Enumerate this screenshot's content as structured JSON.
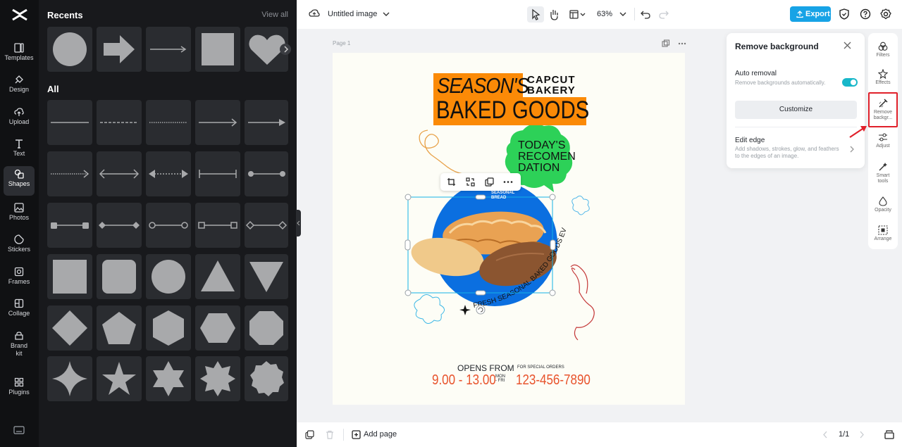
{
  "colors": {
    "accent": "#17a3e6",
    "highlight": "#e0202a",
    "toggle": "#18b7c9",
    "poster_orange": "#fb8a07",
    "poster_blue": "#0b6fe0",
    "poster_green": "#2dd158",
    "poster_red": "#e8532c"
  },
  "rail": {
    "items": [
      {
        "label": "Templates",
        "icon": "templates-icon"
      },
      {
        "label": "Design",
        "icon": "design-icon"
      },
      {
        "label": "Upload",
        "icon": "upload-icon"
      },
      {
        "label": "Text",
        "icon": "text-icon"
      },
      {
        "label": "Shapes",
        "icon": "shapes-icon"
      },
      {
        "label": "Photos",
        "icon": "photos-icon"
      },
      {
        "label": "Stickers",
        "icon": "stickers-icon"
      },
      {
        "label": "Frames",
        "icon": "frames-icon"
      },
      {
        "label": "Collage",
        "icon": "collage-icon"
      },
      {
        "label": "Brand kit",
        "icon": "brand-kit-icon"
      },
      {
        "label": "Plugins",
        "icon": "plugins-icon"
      }
    ]
  },
  "panel": {
    "recents_title": "Recents",
    "view_all": "View all",
    "all_title": "All"
  },
  "topbar": {
    "doc_title": "Untitled image",
    "zoom": "63%",
    "export_label": "Export"
  },
  "canvas": {
    "page_label": "Page 1",
    "poster": {
      "season": "SEASON'S",
      "capcut": "CAPCUT",
      "bakery": "BAKERY",
      "baked_goods": "BAKED GOODS",
      "today_1": "TODAY'S",
      "today_2": "RECOMEN",
      "today_3": "DATION",
      "seasonal": "SEASONAL",
      "bread": "BREAD",
      "curved_text": "FRESH SEASONAL BAKED GOODS EVERYDAY",
      "opens_from": "OPENS FROM",
      "hours": "9.00 - 13.00",
      "mon": "MON",
      "fri": "- FRI",
      "special_orders": "FOR SPECIAL ORDERS",
      "phone": "123-456-7890"
    }
  },
  "remove_bg": {
    "title": "Remove background",
    "auto_label": "Auto removal",
    "auto_desc": "Remove backgrounds automatically.",
    "auto_enabled": true,
    "customize": "Customize",
    "edge_label": "Edit edge",
    "edge_desc": "Add shadows, strokes, glow, and feathers to the edges of an image."
  },
  "right_tools": [
    {
      "label": "Filters",
      "icon": "filters-icon"
    },
    {
      "label": "Effects",
      "icon": "effects-icon"
    },
    {
      "label": "Remove backgr...",
      "icon": "remove-background-icon"
    },
    {
      "label": "Adjust",
      "icon": "adjust-icon"
    },
    {
      "label": "Smart tools",
      "icon": "smart-tools-icon"
    },
    {
      "label": "Opacity",
      "icon": "opacity-icon"
    },
    {
      "label": "Arrange",
      "icon": "arrange-icon"
    }
  ],
  "bottombar": {
    "add_page": "Add page",
    "page_count": "1/1"
  }
}
